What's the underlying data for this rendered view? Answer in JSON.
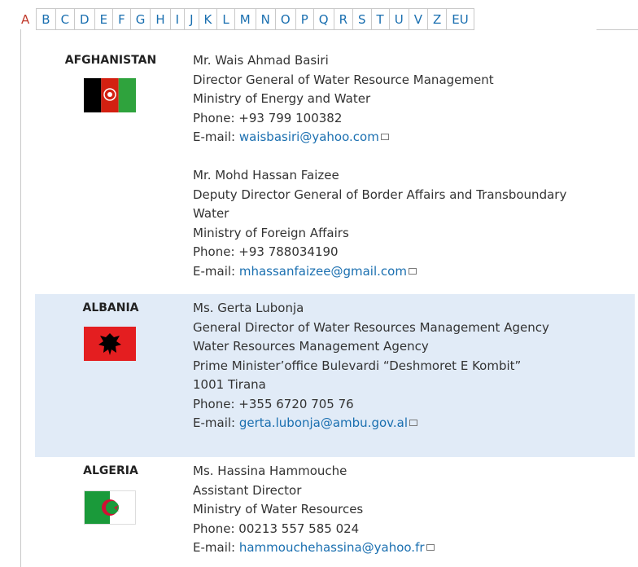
{
  "tabs": [
    "A",
    "B",
    "C",
    "D",
    "E",
    "F",
    "G",
    "H",
    "I",
    "J",
    "K",
    "L",
    "M",
    "N",
    "O",
    "P",
    "Q",
    "R",
    "S",
    "T",
    "U",
    "V",
    "Z",
    "EU"
  ],
  "active_tab": "A",
  "entries": [
    {
      "country": "AFGHANISTAN",
      "flag_icon": "afghanistan-flag-icon",
      "contacts": [
        {
          "lines": [
            "Mr. Wais Ahmad Basiri",
            "Director General of Water Resource Management",
            "Ministry of Energy and Water",
            "Phone: +93 799 100382"
          ],
          "email_prefix": "E-mail: ",
          "email": "waisbasiri@yahoo.com"
        },
        {
          "lines": [
            "Mr. Mohd Hassan Faizee",
            "Deputy Director General of Border Affairs and Transboundary",
            "Water",
            "Ministry of Foreign Affairs",
            "Phone: +93 788034190"
          ],
          "email_prefix": "E-mail: ",
          "email": "mhassanfaizee@gmail.com"
        }
      ]
    },
    {
      "country": "ALBANIA",
      "flag_icon": "albania-flag-icon",
      "contacts": [
        {
          "lines": [
            "Ms. Gerta Lubonja",
            "General Director of Water Resources Management Agency",
            "Water Resources Management Agency",
            "Prime Minister’office Bulevardi “Deshmoret E Kombit”",
            "1001 Tirana",
            "Phone: +355 6720 705 76"
          ],
          "email_prefix": "E-mail: ",
          "email": "gerta.lubonja@ambu.gov.al"
        }
      ]
    },
    {
      "country": "ALGERIA",
      "flag_icon": "algeria-flag-icon",
      "contacts": [
        {
          "lines": [
            "Ms. Hassina Hammouche",
            "Assistant Director",
            "Ministry of Water Resources",
            "Phone: 00213 557 585 024"
          ],
          "email_prefix": "E-mail: ",
          "email": "hammouchehassina@yahoo.fr"
        }
      ]
    }
  ],
  "colors": {
    "link": "#1a6fb0",
    "active_tab": "#c0392b",
    "shaded_row": "#e1ebf7"
  }
}
